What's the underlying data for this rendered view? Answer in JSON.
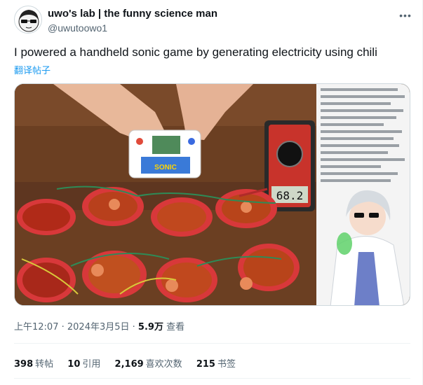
{
  "author": {
    "display_name": "uwo's lab | the funny science man",
    "handle": "@uwutoowo1"
  },
  "menu": {
    "more_icon": "more-horizontal-icon"
  },
  "tweet": {
    "text": "I powered a handheld sonic game by generating electricity using chili",
    "translate_label": "翻译帖子"
  },
  "media": {
    "multimeter_reading": "68.2",
    "game_label": "SONIC"
  },
  "meta": {
    "time": "上午12:07",
    "sep1": " · ",
    "date": "2024年3月5日",
    "sep2": " · ",
    "views": "5.9万",
    "views_label": " 查看"
  },
  "stats": {
    "retweets": "398",
    "retweets_label": "转帖",
    "quotes": "10",
    "quotes_label": "引用",
    "likes": "2,169",
    "likes_label": "喜欢次数",
    "bookmarks": "215",
    "bookmarks_label": "书签"
  }
}
